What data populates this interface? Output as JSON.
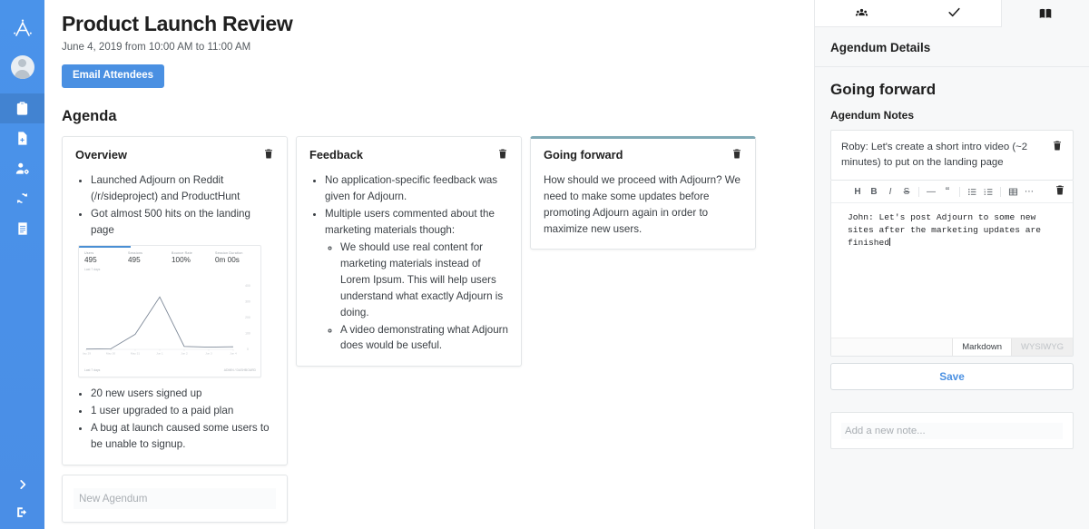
{
  "sidebar": {
    "logo_icon": "adjourn-compass-logo",
    "avatar_icon": "user-avatar",
    "items": [
      {
        "name": "clipboard",
        "icon": "clipboard-icon",
        "active": true
      },
      {
        "name": "new-document",
        "icon": "file-plus-icon",
        "active": false
      },
      {
        "name": "manage-users",
        "icon": "user-settings-icon",
        "active": false
      },
      {
        "name": "sync",
        "icon": "refresh-sync-icon",
        "active": false
      },
      {
        "name": "notes",
        "icon": "notes-list-icon",
        "active": false
      }
    ],
    "bottom_items": [
      {
        "name": "expand-sidebar",
        "icon": "chevron-right-icon"
      },
      {
        "name": "logout",
        "icon": "logout-icon"
      }
    ],
    "background_color": "#4a90e8"
  },
  "header": {
    "title": "Product Launch Review",
    "subtitle": "June 4, 2019 from 10:00 AM to 11:00 AM",
    "email_button_label": "Email Attendees",
    "accent_color": "#4a90e2"
  },
  "agenda": {
    "section_title": "Agenda",
    "cards": [
      {
        "title": "Overview",
        "selected": false,
        "bullets_top": [
          "Launched Adjourn on Reddit (/r/sideproject) and ProductHunt",
          "Got almost 500 hits on the landing page"
        ],
        "bullets_bottom": [
          "20 new users signed up",
          "1 user upgraded to a paid plan",
          "A bug at launch caused some users to be unable to signup."
        ],
        "has_embedded_chart": true
      },
      {
        "title": "Feedback",
        "selected": false,
        "bullets": [
          {
            "text": "No application-specific feedback was given for Adjourn."
          },
          {
            "text": "Multiple users commented about the marketing materials though:",
            "sub": [
              "We should use real content for marketing materials instead of Lorem Ipsum. This will help users understand what exactly Adjourn is doing.",
              "A video demonstrating what Adjourn does would be useful."
            ]
          }
        ]
      },
      {
        "title": "Going forward",
        "selected": true,
        "selected_border_color": "#7fa9b5",
        "paragraph": "How should we proceed with Adjourn? We need to make some updates before promoting Adjourn again in order to maximize new users."
      }
    ],
    "new_agendum_placeholder": "New Agendum",
    "trash_icon": "trash-icon"
  },
  "chart_data": {
    "type": "line",
    "title": "Users",
    "stats": [
      {
        "label": "Users",
        "value": "495"
      },
      {
        "label": "Sessions",
        "value": "495"
      },
      {
        "label": "Bounce Rate",
        "value": "100%"
      },
      {
        "label": "Session Duration",
        "value": "0m 00s"
      }
    ],
    "note": "Last 7 days",
    "footer_left": "Last 7 days",
    "footer_right": "ADMIN / DASHBOARD",
    "x": [
      "May 29",
      "May 30",
      "May 31",
      "Jun 1",
      "Jun 2",
      "Jun 3",
      "Jun 4"
    ],
    "values": [
      2,
      3,
      95,
      330,
      18,
      14,
      16
    ],
    "ylim": [
      0,
      400
    ],
    "yticks": [
      0,
      100,
      200,
      300,
      400
    ],
    "xlabel": "",
    "ylabel": "",
    "grid": false,
    "legend": "none",
    "line_color": "#7f8a99"
  },
  "panel": {
    "tabs": [
      {
        "name": "attendees",
        "icon": "people-group-icon",
        "active": false
      },
      {
        "name": "agenda-check",
        "icon": "checkmark-icon",
        "active": true
      },
      {
        "name": "minutes-book",
        "icon": "book-icon",
        "active": false
      }
    ],
    "header": "Agendum Details",
    "agendum_title": "Going forward",
    "notes_label": "Agendum Notes",
    "notes": [
      {
        "text": "Roby: Let's create a short intro video (~2 minutes) to put on the landing page",
        "trash_icon": "trash-icon"
      }
    ],
    "editor": {
      "toolbar": [
        {
          "name": "heading",
          "glyph": "H"
        },
        {
          "name": "bold",
          "glyph": "B"
        },
        {
          "name": "italic",
          "glyph": "I"
        },
        {
          "name": "strikethrough",
          "glyph": "S"
        },
        {
          "name": "horizontal-rule",
          "glyph": "—"
        },
        {
          "name": "blockquote",
          "glyph": "“"
        },
        {
          "name": "bullet-list",
          "glyph": "☰"
        },
        {
          "name": "numbered-list",
          "glyph": "≡"
        },
        {
          "name": "table",
          "glyph": "⊞"
        },
        {
          "name": "more-options",
          "glyph": "⋯"
        }
      ],
      "trash_icon": "trash-icon",
      "content": "John: Let's post Adjourn to some new sites after the marketing updates are finished",
      "mode_markdown": "Markdown",
      "mode_wysiwyg": "WYSIWYG",
      "active_mode": "Markdown",
      "save_label": "Save"
    },
    "add_note_placeholder": "Add a new note..."
  }
}
